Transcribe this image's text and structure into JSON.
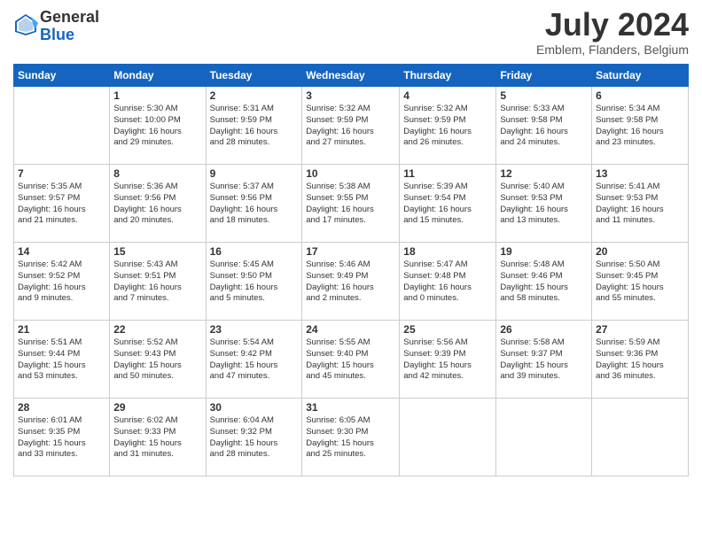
{
  "header": {
    "logo_line1": "General",
    "logo_line2": "Blue",
    "month": "July 2024",
    "location": "Emblem, Flanders, Belgium"
  },
  "days_of_week": [
    "Sunday",
    "Monday",
    "Tuesday",
    "Wednesday",
    "Thursday",
    "Friday",
    "Saturday"
  ],
  "weeks": [
    [
      {
        "day": "",
        "content": ""
      },
      {
        "day": "1",
        "content": "Sunrise: 5:30 AM\nSunset: 10:00 PM\nDaylight: 16 hours\nand 29 minutes."
      },
      {
        "day": "2",
        "content": "Sunrise: 5:31 AM\nSunset: 9:59 PM\nDaylight: 16 hours\nand 28 minutes."
      },
      {
        "day": "3",
        "content": "Sunrise: 5:32 AM\nSunset: 9:59 PM\nDaylight: 16 hours\nand 27 minutes."
      },
      {
        "day": "4",
        "content": "Sunrise: 5:32 AM\nSunset: 9:59 PM\nDaylight: 16 hours\nand 26 minutes."
      },
      {
        "day": "5",
        "content": "Sunrise: 5:33 AM\nSunset: 9:58 PM\nDaylight: 16 hours\nand 24 minutes."
      },
      {
        "day": "6",
        "content": "Sunrise: 5:34 AM\nSunset: 9:58 PM\nDaylight: 16 hours\nand 23 minutes."
      }
    ],
    [
      {
        "day": "7",
        "content": "Sunrise: 5:35 AM\nSunset: 9:57 PM\nDaylight: 16 hours\nand 21 minutes."
      },
      {
        "day": "8",
        "content": "Sunrise: 5:36 AM\nSunset: 9:56 PM\nDaylight: 16 hours\nand 20 minutes."
      },
      {
        "day": "9",
        "content": "Sunrise: 5:37 AM\nSunset: 9:56 PM\nDaylight: 16 hours\nand 18 minutes."
      },
      {
        "day": "10",
        "content": "Sunrise: 5:38 AM\nSunset: 9:55 PM\nDaylight: 16 hours\nand 17 minutes."
      },
      {
        "day": "11",
        "content": "Sunrise: 5:39 AM\nSunset: 9:54 PM\nDaylight: 16 hours\nand 15 minutes."
      },
      {
        "day": "12",
        "content": "Sunrise: 5:40 AM\nSunset: 9:53 PM\nDaylight: 16 hours\nand 13 minutes."
      },
      {
        "day": "13",
        "content": "Sunrise: 5:41 AM\nSunset: 9:53 PM\nDaylight: 16 hours\nand 11 minutes."
      }
    ],
    [
      {
        "day": "14",
        "content": "Sunrise: 5:42 AM\nSunset: 9:52 PM\nDaylight: 16 hours\nand 9 minutes."
      },
      {
        "day": "15",
        "content": "Sunrise: 5:43 AM\nSunset: 9:51 PM\nDaylight: 16 hours\nand 7 minutes."
      },
      {
        "day": "16",
        "content": "Sunrise: 5:45 AM\nSunset: 9:50 PM\nDaylight: 16 hours\nand 5 minutes."
      },
      {
        "day": "17",
        "content": "Sunrise: 5:46 AM\nSunset: 9:49 PM\nDaylight: 16 hours\nand 2 minutes."
      },
      {
        "day": "18",
        "content": "Sunrise: 5:47 AM\nSunset: 9:48 PM\nDaylight: 16 hours\nand 0 minutes."
      },
      {
        "day": "19",
        "content": "Sunrise: 5:48 AM\nSunset: 9:46 PM\nDaylight: 15 hours\nand 58 minutes."
      },
      {
        "day": "20",
        "content": "Sunrise: 5:50 AM\nSunset: 9:45 PM\nDaylight: 15 hours\nand 55 minutes."
      }
    ],
    [
      {
        "day": "21",
        "content": "Sunrise: 5:51 AM\nSunset: 9:44 PM\nDaylight: 15 hours\nand 53 minutes."
      },
      {
        "day": "22",
        "content": "Sunrise: 5:52 AM\nSunset: 9:43 PM\nDaylight: 15 hours\nand 50 minutes."
      },
      {
        "day": "23",
        "content": "Sunrise: 5:54 AM\nSunset: 9:42 PM\nDaylight: 15 hours\nand 47 minutes."
      },
      {
        "day": "24",
        "content": "Sunrise: 5:55 AM\nSunset: 9:40 PM\nDaylight: 15 hours\nand 45 minutes."
      },
      {
        "day": "25",
        "content": "Sunrise: 5:56 AM\nSunset: 9:39 PM\nDaylight: 15 hours\nand 42 minutes."
      },
      {
        "day": "26",
        "content": "Sunrise: 5:58 AM\nSunset: 9:37 PM\nDaylight: 15 hours\nand 39 minutes."
      },
      {
        "day": "27",
        "content": "Sunrise: 5:59 AM\nSunset: 9:36 PM\nDaylight: 15 hours\nand 36 minutes."
      }
    ],
    [
      {
        "day": "28",
        "content": "Sunrise: 6:01 AM\nSunset: 9:35 PM\nDaylight: 15 hours\nand 33 minutes."
      },
      {
        "day": "29",
        "content": "Sunrise: 6:02 AM\nSunset: 9:33 PM\nDaylight: 15 hours\nand 31 minutes."
      },
      {
        "day": "30",
        "content": "Sunrise: 6:04 AM\nSunset: 9:32 PM\nDaylight: 15 hours\nand 28 minutes."
      },
      {
        "day": "31",
        "content": "Sunrise: 6:05 AM\nSunset: 9:30 PM\nDaylight: 15 hours\nand 25 minutes."
      },
      {
        "day": "",
        "content": ""
      },
      {
        "day": "",
        "content": ""
      },
      {
        "day": "",
        "content": ""
      }
    ]
  ]
}
